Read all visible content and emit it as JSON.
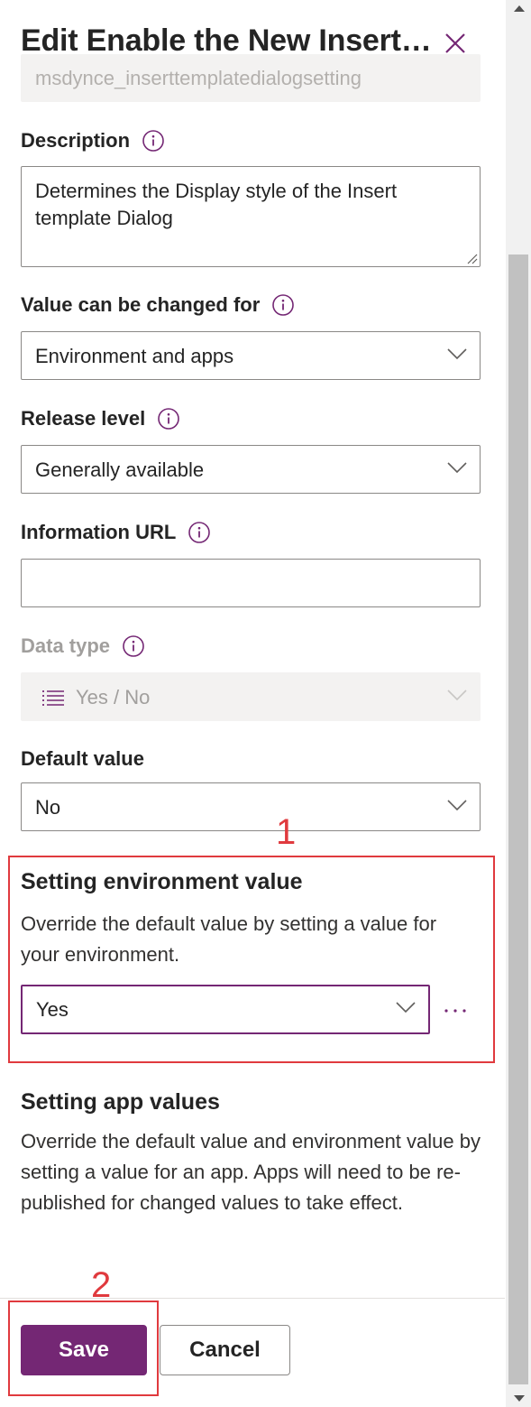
{
  "header": {
    "title": "Edit Enable the New Insert…",
    "close_icon": "close-icon"
  },
  "schema_name_field": {
    "value": "msdynce_inserttemplatedialogsetting"
  },
  "description": {
    "label": "Description",
    "value": "Determines the Display style of the Insert template Dialog"
  },
  "value_can_be_changed_for": {
    "label": "Value can be changed for",
    "selected": "Environment and apps"
  },
  "release_level": {
    "label": "Release level",
    "selected": "Generally available"
  },
  "information_url": {
    "label": "Information URL",
    "value": ""
  },
  "data_type": {
    "label": "Data type",
    "selected": "Yes / No",
    "icon": "list-icon"
  },
  "default_value": {
    "label": "Default value",
    "selected": "No"
  },
  "setting_environment_value": {
    "annotation": "1",
    "title": "Setting environment value",
    "description": "Override the default value by setting a value for your environment.",
    "selected": "Yes",
    "more_icon": "more-options-icon"
  },
  "setting_app_values": {
    "title": "Setting app values",
    "description": "Override the default value and environment value by setting a value for an app. Apps will need to be re-published for changed values to take effect."
  },
  "footer": {
    "annotation": "2",
    "save_label": "Save",
    "cancel_label": "Cancel"
  },
  "colors": {
    "accent": "#742774",
    "annotation": "#e03a3e",
    "disabled_bg": "#f3f2f1"
  }
}
